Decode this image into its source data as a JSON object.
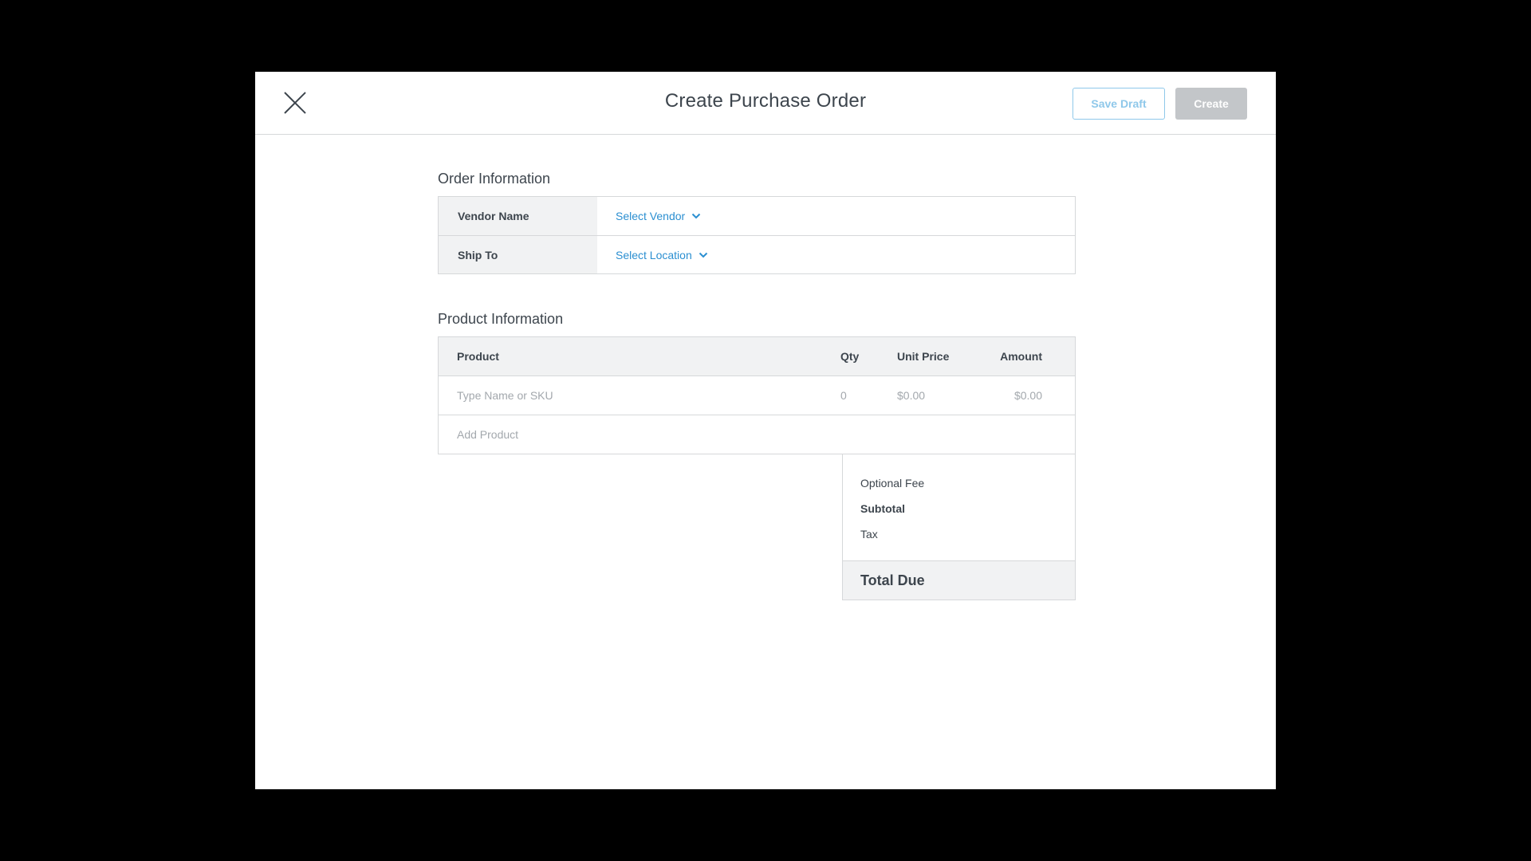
{
  "header": {
    "title": "Create Purchase Order",
    "save_draft_label": "Save Draft",
    "create_label": "Create"
  },
  "order_info": {
    "title": "Order Information",
    "vendor_label": "Vendor Name",
    "vendor_value": "Select Vendor",
    "ship_label": "Ship To",
    "ship_value": "Select Location"
  },
  "product_info": {
    "title": "Product Information",
    "columns": [
      "Product",
      "Qty",
      "Unit Price",
      "Amount"
    ],
    "row": {
      "product_placeholder": "Type Name or SKU",
      "qty": "0",
      "unit_price": "$0.00",
      "amount": "$0.00"
    },
    "add_product_label": "Add Product"
  },
  "summary": {
    "optional_fee": "Optional Fee",
    "subtotal": "Subtotal",
    "tax": "Tax",
    "total_due": "Total Due"
  },
  "colors": {
    "link": "#2b8fd1",
    "draft_border": "#8fc8ea",
    "create_disabled": "#c3c6c9"
  },
  "icons": {
    "close": "close-icon",
    "chevron": "chevron-down-icon"
  }
}
